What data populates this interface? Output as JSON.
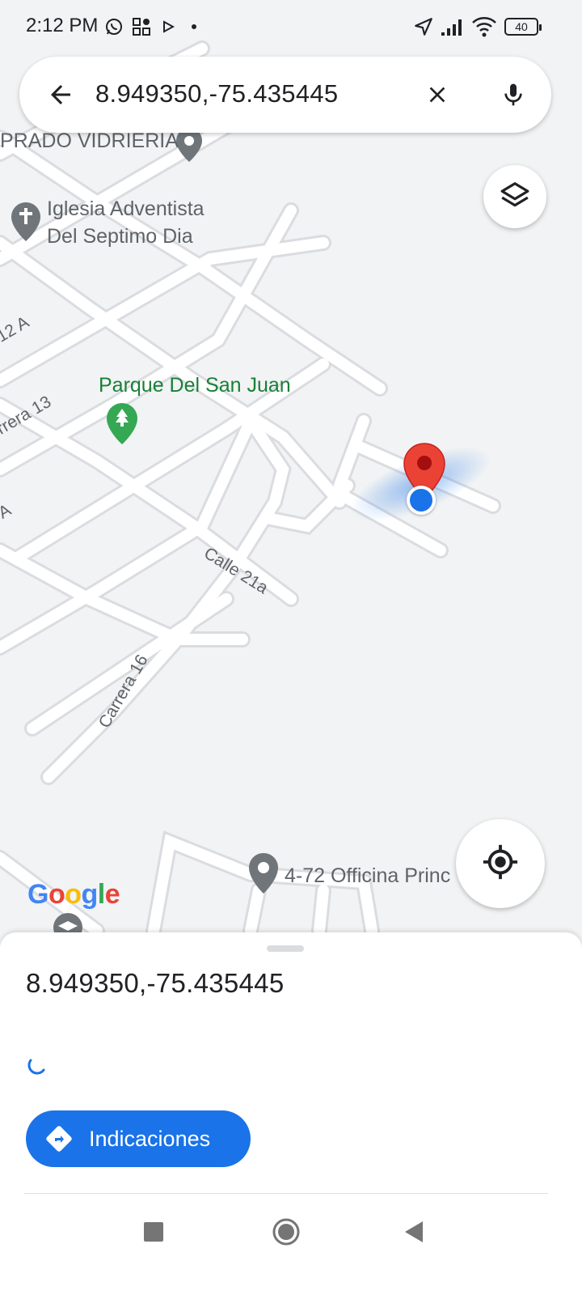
{
  "status_bar": {
    "time": "2:12 PM",
    "battery": "40",
    "icons": [
      "whatsapp-icon",
      "qr-app-icon",
      "play-icon",
      "dot-icon",
      "location-arrow-icon",
      "signal-icon",
      "wifi-icon",
      "battery-icon"
    ]
  },
  "search": {
    "query": "8.949350,-75.435445",
    "icons": [
      "back-arrow-icon",
      "close-icon",
      "mic-icon"
    ]
  },
  "map": {
    "places": {
      "prado": "PRADO VIDRIERIA",
      "iglesia_line1": "Iglesia Adventista",
      "iglesia_line2": "Del Septimo Dia",
      "parque": "Parque Del San Juan",
      "office": "4-72 Officina Princ"
    },
    "streets": {
      "s12a": "12 A",
      "carrera13": "rrera 13",
      "a": "A",
      "calle21a": "Calle 21a",
      "carrera16": "Carrera 16"
    },
    "logo": [
      "G",
      "o",
      "o",
      "g",
      "l",
      "e"
    ],
    "colors": {
      "background": "#f1f3f4",
      "road": "#ffffff",
      "pin_red": "#ea4335",
      "location_blue": "#1a73e8",
      "park_green": "#188038"
    }
  },
  "controls": {
    "layers_icon": "layers-icon",
    "my_location_icon": "my-location-icon"
  },
  "sheet": {
    "title": "8.949350,-75.435445",
    "directions_label": "Indicaciones"
  },
  "nav": {
    "icons": [
      "recents-square-icon",
      "home-circle-icon",
      "back-triangle-icon"
    ]
  }
}
